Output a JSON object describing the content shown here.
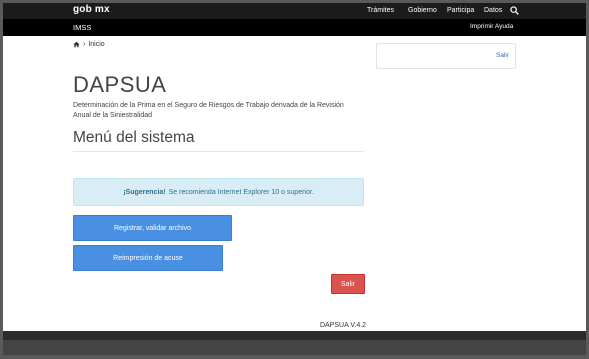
{
  "gobnav": {
    "logo": "gob mx",
    "links": [
      "Trámites",
      "Gobierno",
      "Participa",
      "Datos"
    ]
  },
  "imssbar": {
    "title": "IMSS",
    "links_text": "Imprimir Ayuda"
  },
  "breadcrumb": {
    "separator": "›",
    "label": "Inicio"
  },
  "side_panel": {
    "link": "Salir"
  },
  "main": {
    "title": "DAPSUA",
    "subtitle": "Determinación de la Prima en el Seguro de Riesgos de Trabajo derivada de la Revisión Anual de la Siniestralidad",
    "menu_title": "Menú del sistema",
    "alert_strong": "¡Sugerencia!",
    "alert_text": "Se recomienda Internet Explorer 10 o superior.",
    "btn_registrar": "Registrar, validar archivo",
    "btn_reimpresion": "Reimpresión de acuse",
    "btn_salir": "Salir",
    "version": "DAPSUA V.4.2"
  },
  "colors": {
    "primary_button": "#4a90e2",
    "danger_button": "#d9534f",
    "alert_bg": "#d9edf7",
    "top_bar": "#1b1b1b"
  }
}
